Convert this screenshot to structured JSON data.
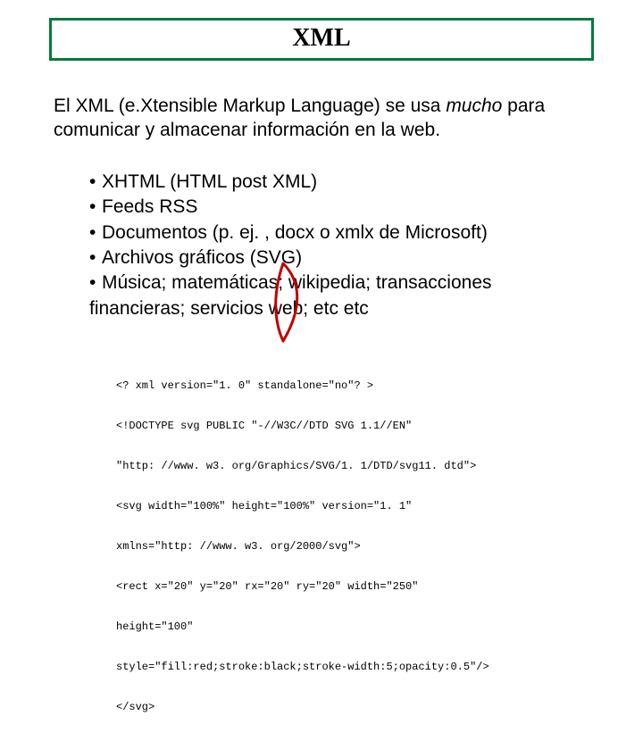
{
  "title": "XML",
  "intro": {
    "before_emph": "El XML (e.Xtensible Markup Language) se usa ",
    "emph": "mucho",
    "after_emph": " para comunicar y almacenar información en la web."
  },
  "bullets": [
    "XHTML (HTML post XML)",
    "Feeds RSS",
    "Documentos (p. ej. , docx o xmlx de Microsoft)",
    "Archivos gráficos (SVG)",
    "Música; matemáticas; wikipedia; transacciones financieras; servicios web; etc etc"
  ],
  "code_lines": [
    "<? xml version=\"1. 0\" standalone=\"no\"? >",
    "<!DOCTYPE svg PUBLIC \"-//W3C//DTD SVG 1.1//EN\"",
    "\"http: //www. w3. org/Graphics/SVG/1. 1/DTD/svg11. dtd\">",
    "<svg width=\"100%\" height=\"100%\" version=\"1. 1\"",
    "xmlns=\"http: //www. w3. org/2000/svg\">",
    "<rect x=\"20\" y=\"20\" rx=\"20\" ry=\"20\" width=\"250\"",
    "height=\"100\"",
    "style=\"fill:red;stroke:black;stroke-width:5;opacity:0.5\"/>",
    "</svg>"
  ]
}
